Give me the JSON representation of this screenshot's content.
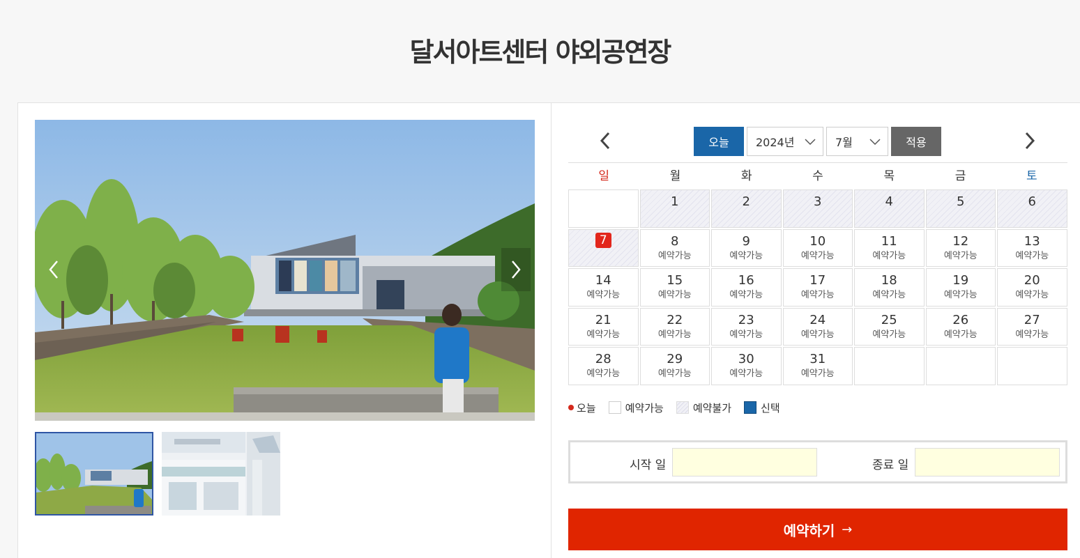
{
  "page": {
    "title": "달서아트센터 야외공연장"
  },
  "gallery": {
    "prev_icon": "chevron-left-icon",
    "next_icon": "chevron-right-icon",
    "thumbnails": [
      {
        "name": "thumb-outdoor-stage",
        "selected": true
      },
      {
        "name": "thumb-building-entrance",
        "selected": false
      }
    ]
  },
  "calendar": {
    "today_label": "오늘",
    "year_value": "2024년",
    "month_value": "7월",
    "apply_label": "적용",
    "weekdays": [
      "일",
      "월",
      "화",
      "수",
      "목",
      "금",
      "토"
    ],
    "available_label": "예약가능",
    "weeks": [
      [
        {
          "day": "",
          "state": "empty"
        },
        {
          "day": "1",
          "state": "blocked"
        },
        {
          "day": "2",
          "state": "blocked"
        },
        {
          "day": "3",
          "state": "blocked"
        },
        {
          "day": "4",
          "state": "blocked"
        },
        {
          "day": "5",
          "state": "blocked"
        },
        {
          "day": "6",
          "state": "blocked"
        }
      ],
      [
        {
          "day": "7",
          "state": "today"
        },
        {
          "day": "8",
          "state": "available"
        },
        {
          "day": "9",
          "state": "available"
        },
        {
          "day": "10",
          "state": "available"
        },
        {
          "day": "11",
          "state": "available"
        },
        {
          "day": "12",
          "state": "available"
        },
        {
          "day": "13",
          "state": "available"
        }
      ],
      [
        {
          "day": "14",
          "state": "available"
        },
        {
          "day": "15",
          "state": "available"
        },
        {
          "day": "16",
          "state": "available"
        },
        {
          "day": "17",
          "state": "available"
        },
        {
          "day": "18",
          "state": "available"
        },
        {
          "day": "19",
          "state": "available"
        },
        {
          "day": "20",
          "state": "available"
        }
      ],
      [
        {
          "day": "21",
          "state": "available"
        },
        {
          "day": "22",
          "state": "available"
        },
        {
          "day": "23",
          "state": "available"
        },
        {
          "day": "24",
          "state": "available"
        },
        {
          "day": "25",
          "state": "available"
        },
        {
          "day": "26",
          "state": "available"
        },
        {
          "day": "27",
          "state": "available"
        }
      ],
      [
        {
          "day": "28",
          "state": "available"
        },
        {
          "day": "29",
          "state": "available"
        },
        {
          "day": "30",
          "state": "available"
        },
        {
          "day": "31",
          "state": "available"
        },
        {
          "day": "",
          "state": "empty"
        },
        {
          "day": "",
          "state": "empty"
        },
        {
          "day": "",
          "state": "empty"
        }
      ]
    ]
  },
  "legend": {
    "today": "오늘",
    "available": "예약가능",
    "unavailable": "예약불가",
    "selected": "신택"
  },
  "dates": {
    "start_label": "시작 일",
    "end_label": "종료 일",
    "start_value": "",
    "end_value": ""
  },
  "reserve": {
    "label": "예약하기",
    "arrow": "→"
  },
  "colors": {
    "primary_blue": "#1a66a8",
    "reserve_red": "#e02500",
    "today_red": "#e2261c",
    "apply_gray": "#666666",
    "date_input_bg": "#ffffe0"
  }
}
